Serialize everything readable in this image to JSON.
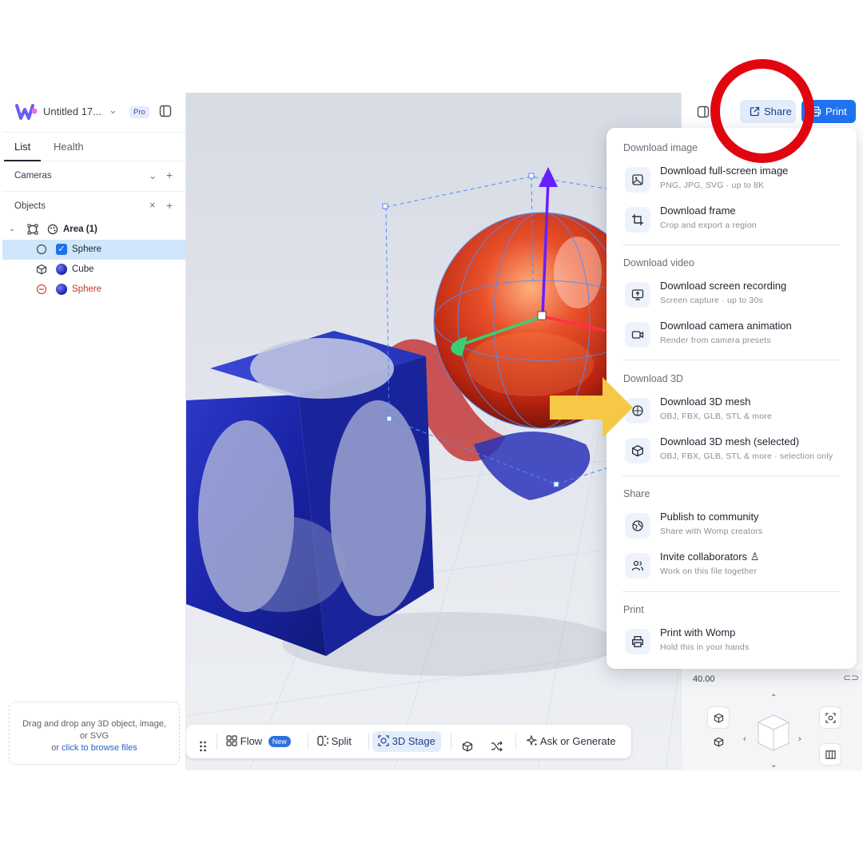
{
  "app": {
    "file_title": "Untitled 17...",
    "plan_badge": "Pro"
  },
  "sidebar": {
    "tabs": [
      {
        "label": "List",
        "active": true
      },
      {
        "label": "Health",
        "active": false
      }
    ],
    "sections": {
      "cameras": "Cameras",
      "objects": "Objects"
    },
    "tree": [
      {
        "label": "Area (1)",
        "icon": "area-icon",
        "type": "group",
        "expanded": true
      },
      {
        "label": "Sphere",
        "icon": "sphere-icon",
        "selected": true,
        "checked": true
      },
      {
        "label": "Cube",
        "icon": "cube-icon",
        "selected": false
      },
      {
        "label": "Sphere",
        "icon": "subtract-icon",
        "selected": false,
        "color": "#c0392b"
      }
    ],
    "dropzone": {
      "text": "Drag and drop any 3D object, image, or SVG",
      "prefix": "or",
      "link": "click to browse files"
    }
  },
  "toolbar": {
    "flow": "Flow",
    "flow_badge": "New",
    "split": "Split",
    "stage": "3D Stage",
    "ask": "Ask or Generate"
  },
  "header_actions": {
    "share": "Share",
    "print": "Print"
  },
  "right_panel": {
    "value": "40.00"
  },
  "menu": {
    "sections": [
      {
        "title": "Download image",
        "items": [
          {
            "title": "Download full-screen image",
            "subtitle": "PNG, JPG, SVG · up to 8K",
            "icon": "image-icon"
          },
          {
            "title": "Download frame",
            "subtitle": "Crop and export a region",
            "icon": "crop-icon"
          }
        ]
      },
      {
        "title": "Download video",
        "items": [
          {
            "title": "Download screen recording",
            "subtitle": "Screen capture · up to 30s",
            "icon": "screen-record-icon"
          },
          {
            "title": "Download camera animation",
            "subtitle": "Render from camera presets",
            "icon": "video-camera-icon"
          }
        ]
      },
      {
        "title": "Download 3D",
        "items": [
          {
            "title": "Download 3D mesh",
            "subtitle": "OBJ, FBX, GLB, STL & more",
            "icon": "mesh-icon"
          },
          {
            "title": "Download 3D mesh (selected)",
            "subtitle": "OBJ, FBX, GLB, STL & more · selection only",
            "icon": "cube-icon"
          }
        ]
      },
      {
        "title": "Share",
        "items": [
          {
            "title": "Publish to community",
            "subtitle": "Share with Womp creators",
            "icon": "globe-icon"
          },
          {
            "title": "Invite collaborators ♙",
            "subtitle": "Work on this file together",
            "icon": "users-icon"
          }
        ]
      },
      {
        "title": "Print",
        "items": [
          {
            "title": "Print with Womp",
            "subtitle": "Hold this in your hands",
            "icon": "printer-icon"
          }
        ]
      }
    ]
  },
  "annotations": {
    "arrow_color": "#f7c846",
    "circle_color": "#e1050f"
  }
}
